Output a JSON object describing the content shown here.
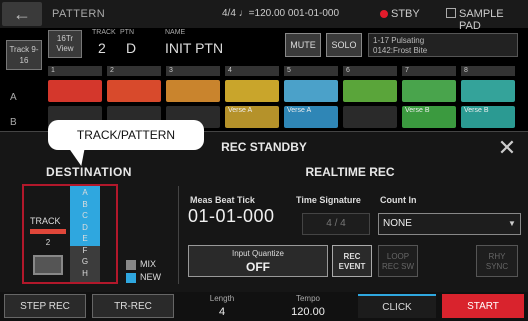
{
  "header": {
    "title": "PATTERN",
    "status": "4/4 ♩=120.00  001-01-000",
    "stby": "STBY",
    "sample_pad": "SAMPLE PAD",
    "stby_color": "#e21b2b"
  },
  "info": {
    "track_btn": "Track 9-16",
    "view_btn": "16Tr View",
    "track_label": "TRACK",
    "ptn_label": "PTN",
    "name_label": "NAME",
    "track_value": "2",
    "ptn_value": "D",
    "name_value": "INIT PTN",
    "mute": "MUTE",
    "solo": "SOLO",
    "tone_line1": "1-17 Pulsating",
    "tone_line2": "0142:Frost Bite"
  },
  "grid": {
    "rows": [
      "A",
      "B"
    ],
    "columns": [
      {
        "num": "1",
        "a_color": "#d4372c",
        "a_text": "",
        "b_color": "#2a2a2a",
        "b_text": ""
      },
      {
        "num": "2",
        "a_color": "#d84a2c",
        "a_text": "",
        "b_color": "#2a2a2a",
        "b_text": ""
      },
      {
        "num": "3",
        "a_color": "#c9842d",
        "a_text": "",
        "b_color": "#2a2a2a",
        "b_text": ""
      },
      {
        "num": "4",
        "a_color": "#c9a52b",
        "a_text": "",
        "b_color": "#b5922a",
        "b_text": "Verse A"
      },
      {
        "num": "5",
        "a_color": "#4ba1c9",
        "a_text": "",
        "b_color": "#2f86b6",
        "b_text": "Verse A"
      },
      {
        "num": "6",
        "a_color": "#5aa53a",
        "a_text": "",
        "b_color": "#2a2a2a",
        "b_text": ""
      },
      {
        "num": "7",
        "a_color": "#49a44c",
        "a_text": "",
        "b_color": "#3b9a3f",
        "b_text": "Verse B"
      },
      {
        "num": "8",
        "a_color": "#34a39a",
        "a_text": "",
        "b_color": "#2b9a92",
        "b_text": "Verse B"
      }
    ]
  },
  "dialog": {
    "title": "REC STANDBY",
    "close": "✕",
    "callout": "TRACK/PATTERN"
  },
  "destination": {
    "label": "DESTINATION",
    "track_label": "TRACK",
    "track_num": "2",
    "letters": [
      "A",
      "B",
      "C",
      "D",
      "E",
      "F",
      "G",
      "H"
    ],
    "mix": "MIX",
    "new": "NEW",
    "new_color": "#2fa7df"
  },
  "realtime": {
    "title": "REALTIME REC",
    "meas_label": "Meas Beat  Tick",
    "position": "01-01-000",
    "timesig_label": "Time Signature",
    "timesig_value": "4 / 4",
    "countin_label": "Count In",
    "countin_value": "NONE",
    "iq_label": "Input Quantize",
    "iq_value": "OFF",
    "rec_event": "REC EVENT",
    "loop_rec": "LOOP REC SW",
    "rhy_sync": "RHY SYNC"
  },
  "bottom": {
    "step_rec": "STEP REC",
    "tr_rec": "TR-REC",
    "length_label": "Length",
    "length_value": "4",
    "tempo_label": "Tempo",
    "tempo_value": "120.00",
    "click": "CLICK",
    "start": "START",
    "start_color": "#d9232d"
  }
}
